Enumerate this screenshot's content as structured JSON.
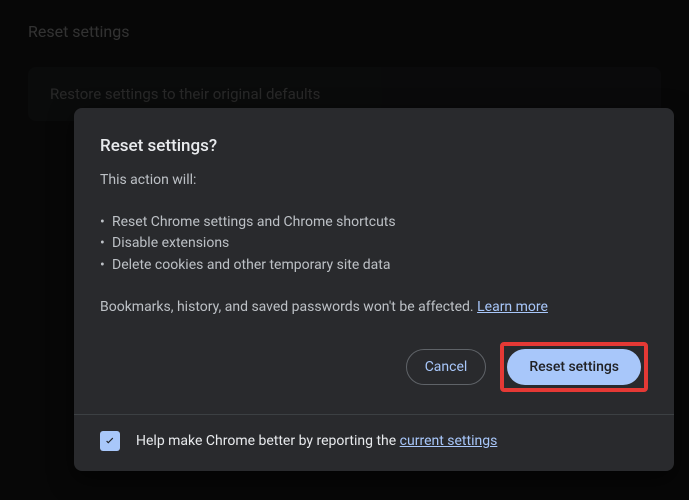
{
  "page": {
    "title": "Reset settings",
    "row_label": "Restore settings to their original defaults"
  },
  "dialog": {
    "title": "Reset settings?",
    "intro": "This action will:",
    "bullets": [
      "Reset Chrome settings and Chrome shortcuts",
      "Disable extensions",
      "Delete cookies and other temporary site data"
    ],
    "note_prefix": "Bookmarks, history, and saved passwords won't be affected.",
    "learn_more": "Learn more",
    "cancel_label": "Cancel",
    "confirm_label": "Reset settings",
    "footer_prefix": "Help make Chrome better by reporting the ",
    "footer_link": "current settings",
    "footer_checked": true
  },
  "colors": {
    "accent": "#a8c7fa",
    "highlight": "#e53935",
    "dialog_bg": "#292a2d"
  }
}
